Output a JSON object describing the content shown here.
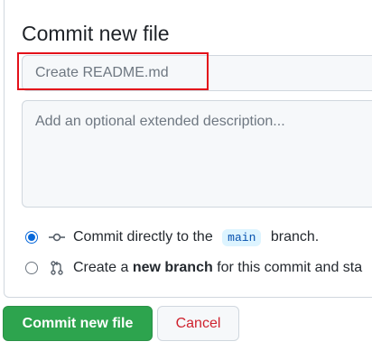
{
  "panel": {
    "title": "Commit new file"
  },
  "commit_summary": {
    "placeholder": "Create README.md",
    "value": ""
  },
  "commit_description": {
    "placeholder": "Add an optional extended description..."
  },
  "options": {
    "direct": {
      "selected": true,
      "prefix": "Commit directly to the",
      "branch": "main",
      "suffix": "branch."
    },
    "new_branch": {
      "selected": false,
      "prefix": "Create a",
      "bold": "new branch",
      "suffix": "for this commit and sta"
    }
  },
  "buttons": {
    "commit_label": "Commit new file",
    "cancel_label": "Cancel"
  },
  "colors": {
    "commit_green": "#2da44e",
    "cancel_red": "#cf222e",
    "highlight_red": "#e3101a",
    "radio_blue": "#0969da"
  },
  "icons": {
    "direct": "git-commit-icon",
    "new_branch": "git-pull-request-icon"
  }
}
